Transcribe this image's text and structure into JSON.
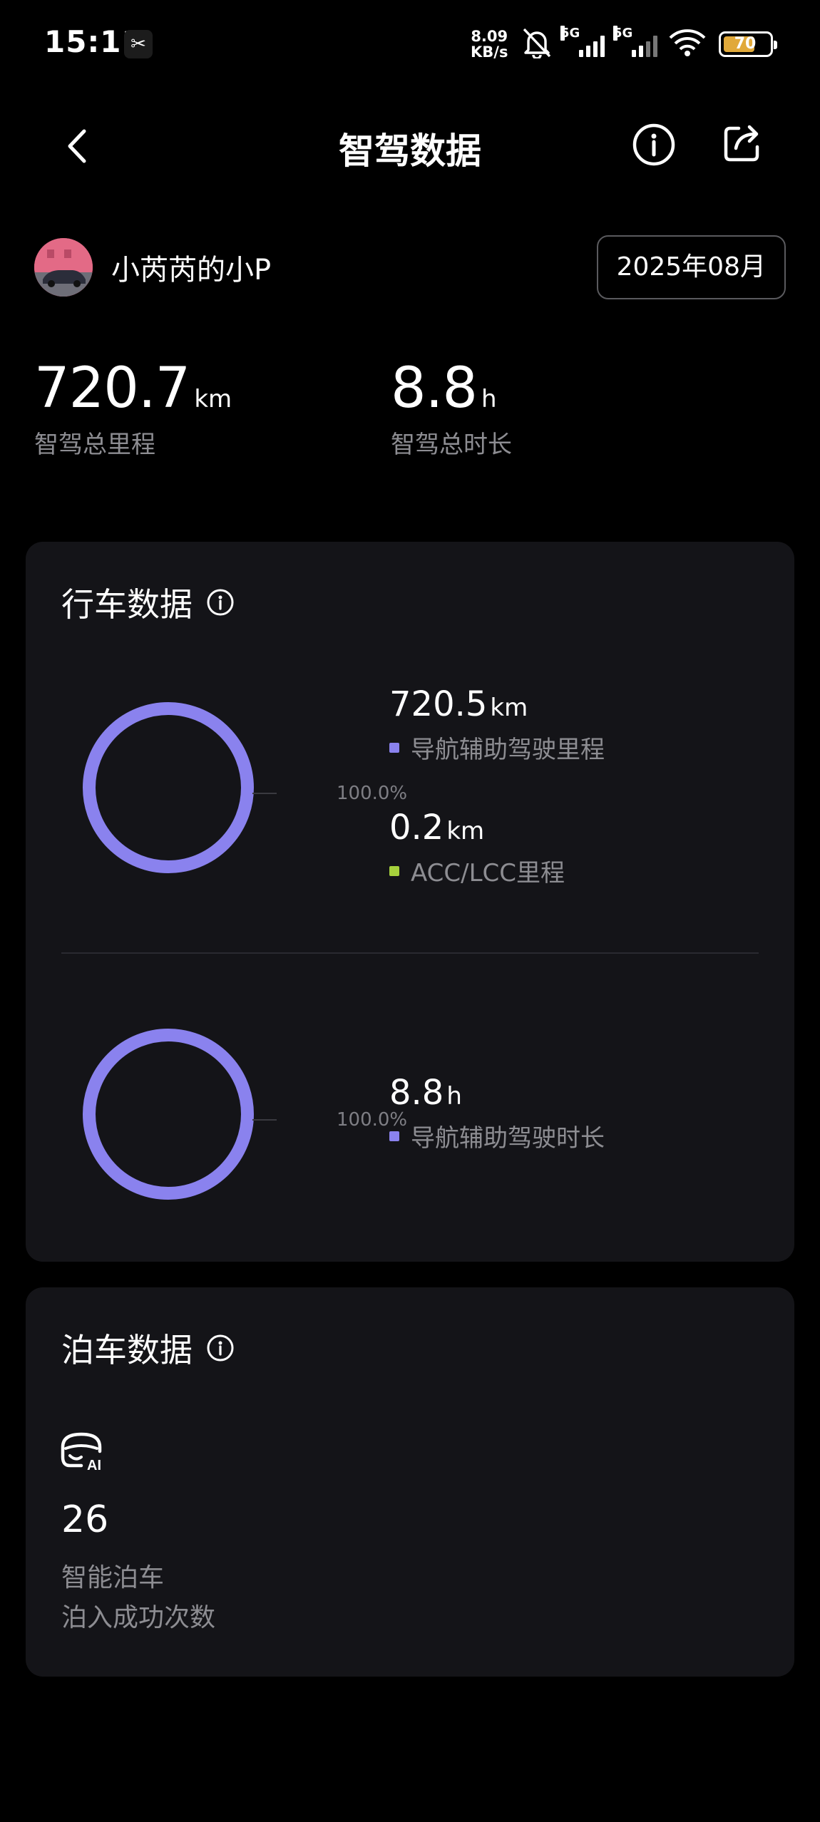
{
  "status_bar": {
    "time": "15:11",
    "app_icon_glyph": "✂",
    "net_speed_value": "8.09",
    "net_speed_unit": "KB/s",
    "signal1_label": "5G",
    "signal2_label": "5G",
    "battery_level": "70",
    "battery_percent": 70,
    "icons": [
      "mute-bell-icon",
      "signal-icon",
      "signal-icon",
      "wifi-icon",
      "battery-icon"
    ]
  },
  "header": {
    "title": "智驾数据",
    "icons": [
      "back-icon",
      "info-icon",
      "share-icon"
    ]
  },
  "profile": {
    "name": "小芮芮的小P",
    "month": "2025年08月"
  },
  "summary": {
    "total_distance_value": "720.7",
    "total_distance_unit": "km",
    "total_distance_label": "智驾总里程",
    "total_duration_value": "8.8",
    "total_duration_unit": "h",
    "total_duration_label": "智驾总时长"
  },
  "driving": {
    "title": "行车数据",
    "distance_chart": {
      "percent_label": "100.0%",
      "items": [
        {
          "value": "720.5",
          "unit": "km",
          "label": "导航辅助驾驶里程",
          "color": "#8a82ee"
        },
        {
          "value": "0.2",
          "unit": "km",
          "label": "ACC/LCC里程",
          "color": "#a6d13c"
        }
      ]
    },
    "duration_chart": {
      "percent_label": "100.0%",
      "items": [
        {
          "value": "8.8",
          "unit": "h",
          "label": "导航辅助驾驶时长",
          "color": "#8a82ee"
        }
      ]
    }
  },
  "parking": {
    "title": "泊车数据",
    "icon": "ai-parking-icon",
    "icon_text": "AI",
    "count": "26",
    "label_line1": "智能泊车",
    "label_line2": "泊入成功次数"
  },
  "colors": {
    "accent_purple": "#8a82ee",
    "accent_green": "#a6d13c",
    "card_bg": "#141418",
    "secondary_text": "#8d8d92"
  }
}
